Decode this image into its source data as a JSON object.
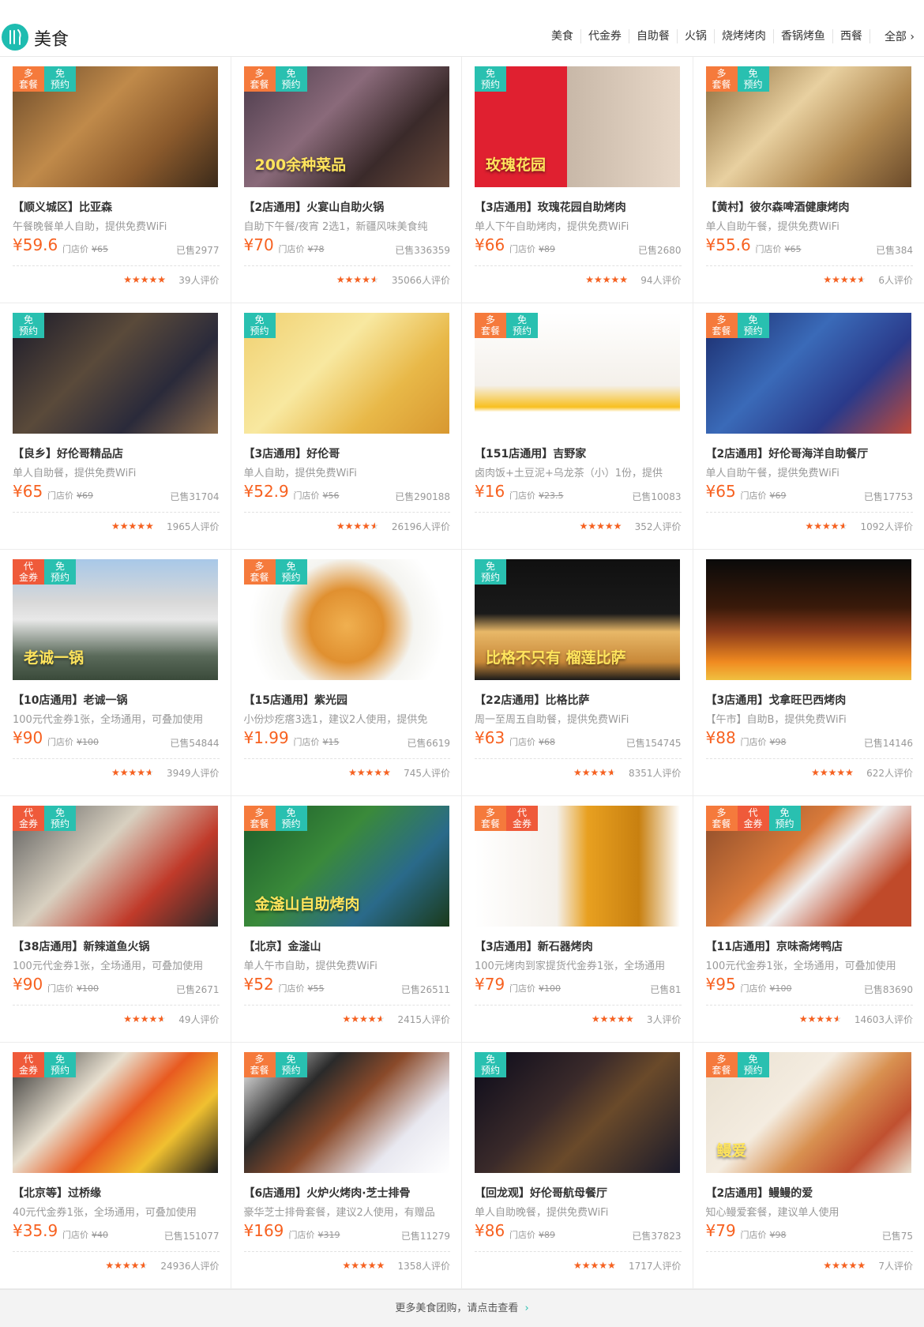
{
  "header": {
    "title": "美食",
    "icon": "fork-knife-icon",
    "nav": [
      "美食",
      "代金券",
      "自助餐",
      "火锅",
      "烧烤烤肉",
      "香锅烤鱼",
      "西餐"
    ],
    "all_label": "全部",
    "brand_color": "#1ebcb0"
  },
  "deals": [
    {
      "tags": [
        {
          "text": "多\n套餐",
          "type": "orange"
        },
        {
          "text": "免\n预约",
          "type": "teal"
        }
      ],
      "name": "【顺义城区】比亚森",
      "desc": "午餐晚餐单人自助，提供免费WiFi",
      "price": "¥59.6",
      "orig_label": "门店价",
      "orig": "¥65",
      "sold": "已售2977",
      "rating": 4.5,
      "reviews": "39人评价",
      "overlay": "",
      "grad": "linear-gradient(135deg,#6b4a2a,#c08a4a 40%,#8b5a2c 70%,#3b2a1a)"
    },
    {
      "tags": [
        {
          "text": "多\n套餐",
          "type": "orange"
        },
        {
          "text": "免\n预约",
          "type": "teal"
        }
      ],
      "name": "【2店通用】火宴山自助火锅",
      "desc": "自助下午餐/夜宵 2选1，新疆风味美食纯",
      "price": "¥70",
      "orig_label": "门店价",
      "orig": "¥78",
      "sold": "已售336359",
      "rating": 4.0,
      "reviews": "35066人评价",
      "overlay": "200余种菜品",
      "grad": "linear-gradient(135deg,#4a3a4a,#8a6a7a 40%,#3a2a2a 70%,#6a4a3a)"
    },
    {
      "tags": [
        {
          "text": "免\n预约",
          "type": "teal"
        }
      ],
      "name": "【3店通用】玫瑰花园自助烤肉",
      "desc": "单人下午自助烤肉，提供免费WiFi",
      "price": "¥66",
      "orig_label": "门店价",
      "orig": "¥89",
      "sold": "已售2680",
      "rating": 4.5,
      "reviews": "94人评价",
      "overlay": "玫瑰花园",
      "grad": "linear-gradient(90deg,#e02030 0,#e02030 45%,#c8b8a8 45%,#e8d8c8 100%)"
    },
    {
      "tags": [
        {
          "text": "多\n套餐",
          "type": "orange"
        },
        {
          "text": "免\n预约",
          "type": "teal"
        }
      ],
      "name": "【黄村】彼尔森啤酒健康烤肉",
      "desc": "单人自助午餐，提供免费WiFi",
      "price": "¥55.6",
      "orig_label": "门店价",
      "orig": "¥65",
      "sold": "已售384",
      "rating": 4.0,
      "reviews": "6人评价",
      "overlay": "",
      "grad": "linear-gradient(135deg,#8a6a3a,#e8d0a0 40%,#b08850 70%,#6a4a2a)"
    },
    {
      "tags": [
        {
          "text": "免\n预约",
          "type": "teal"
        }
      ],
      "name": "【良乡】好伦哥精品店",
      "desc": "单人自助餐，提供免费WiFi",
      "price": "¥65",
      "orig_label": "门店价",
      "orig": "¥69",
      "sold": "已售31704",
      "rating": 4.5,
      "reviews": "1965人评价",
      "overlay": "",
      "grad": "linear-gradient(135deg,#1a1a2a,#5a4a3a 40%,#2a2a3a 70%,#8a6a4a)"
    },
    {
      "tags": [
        {
          "text": "免\n预约",
          "type": "teal"
        }
      ],
      "name": "【3店通用】好伦哥",
      "desc": "单人自助，提供免费WiFi",
      "price": "¥52.9",
      "orig_label": "门店价",
      "orig": "¥56",
      "sold": "已售290188",
      "rating": 4.0,
      "reviews": "26196人评价",
      "overlay": "",
      "grad": "linear-gradient(135deg,#f0d070,#f8e8a0 40%,#e8b848 70%,#d89830)"
    },
    {
      "tags": [
        {
          "text": "多\n套餐",
          "type": "orange"
        },
        {
          "text": "免\n预约",
          "type": "teal"
        }
      ],
      "name": "【151店通用】吉野家",
      "desc": "卤肉饭+土豆泥+乌龙茶（小）1份，提供",
      "price": "¥16",
      "orig_label": "门店价",
      "orig": "¥23.5",
      "sold": "已售10083",
      "rating": 4.5,
      "reviews": "352人评价",
      "overlay": "",
      "grad": "linear-gradient(180deg,#ffffff 0,#f4f0ea 60%,#f8c020 78%,#ffffff 82%)"
    },
    {
      "tags": [
        {
          "text": "多\n套餐",
          "type": "orange"
        },
        {
          "text": "免\n预约",
          "type": "teal"
        }
      ],
      "name": "【2店通用】好伦哥海洋自助餐厅",
      "desc": "单人自助午餐，提供免费WiFi",
      "price": "¥65",
      "orig_label": "门店价",
      "orig": "¥69",
      "sold": "已售17753",
      "rating": 4.0,
      "reviews": "1092人评价",
      "overlay": "",
      "grad": "linear-gradient(135deg,#1a2a6a,#3a6ab8 40%,#2a3a8a 70%,#c04a3a)"
    },
    {
      "tags": [
        {
          "text": "代\n金券",
          "type": "red"
        },
        {
          "text": "免\n预约",
          "type": "teal"
        }
      ],
      "name": "【10店通用】老诚一锅",
      "desc": "100元代金券1张，全场通用，可叠加使用",
      "price": "¥90",
      "orig_label": "门店价",
      "orig": "¥100",
      "sold": "已售54844",
      "rating": 4.0,
      "reviews": "3949人评价",
      "overlay": "老诚一锅",
      "grad": "linear-gradient(180deg,#a8c8e8,#d8d8d8 35%,#e8e8e8 50%,#5a6a5a 80%,#3a4a3a)"
    },
    {
      "tags": [
        {
          "text": "多\n套餐",
          "type": "orange"
        },
        {
          "text": "免\n预约",
          "type": "teal"
        }
      ],
      "name": "【15店通用】紫光园",
      "desc": "小份炒疙瘩3选1，建议2人使用，提供免",
      "price": "¥1.99",
      "orig_label": "门店价",
      "orig": "¥15",
      "sold": "已售6619",
      "rating": 5.0,
      "reviews": "745人评价",
      "overlay": "",
      "grad": "radial-gradient(circle at 50% 55%,#f0b050 0,#e09030 30%,#f4f4f0 55%,#ffffff 80%)"
    },
    {
      "tags": [
        {
          "text": "免\n预约",
          "type": "teal"
        }
      ],
      "name": "【22店通用】比格比萨",
      "desc": "周一至周五自助餐，提供免费WiFi",
      "price": "¥63",
      "orig_label": "门店价",
      "orig": "¥68",
      "sold": "已售154745",
      "rating": 4.0,
      "reviews": "8351人评价",
      "overlay": "比格不只有 榴莲比萨",
      "grad": "linear-gradient(180deg,#101010 0,#1a1a1a 45%,#e8b868 60%,#c88838 85%,#1a1a1a)"
    },
    {
      "tags": [],
      "name": "【3店通用】戈拿旺巴西烤肉",
      "desc": "【午市】自助B，提供免费WiFi",
      "price": "¥88",
      "orig_label": "门店价",
      "orig": "¥98",
      "sold": "已售14146",
      "rating": 4.5,
      "reviews": "622人评价",
      "overlay": "",
      "grad": "linear-gradient(180deg,#0a0a0a 0,#3a1a0a 40%,#8a3a1a 60%,#f08a20 85%,#f0c040)"
    },
    {
      "tags": [
        {
          "text": "代\n金券",
          "type": "red"
        },
        {
          "text": "免\n预约",
          "type": "teal"
        }
      ],
      "name": "【38店通用】新辣道鱼火锅",
      "desc": "100元代金券1张，全场通用，可叠加使用",
      "price": "¥90",
      "orig_label": "门店价",
      "orig": "¥100",
      "sold": "已售2671",
      "rating": 4.0,
      "reviews": "49人评价",
      "overlay": "",
      "grad": "linear-gradient(135deg,#5a5a5a,#d8d0c0 40%,#c03a2a 70%,#2a2a2a)"
    },
    {
      "tags": [
        {
          "text": "多\n套餐",
          "type": "orange"
        },
        {
          "text": "免\n预约",
          "type": "teal"
        }
      ],
      "name": "【北京】金滏山",
      "desc": "单人午市自助，提供免费WiFi",
      "price": "¥52",
      "orig_label": "门店价",
      "orig": "¥55",
      "sold": "已售26511",
      "rating": 4.0,
      "reviews": "2415人评价",
      "overlay": "金滏山自助烤肉",
      "grad": "linear-gradient(135deg,#1a5a2a,#3a8a3a 40%,#2a6a8a 70%,#1a3a1a)"
    },
    {
      "tags": [
        {
          "text": "多\n套餐",
          "type": "orange"
        },
        {
          "text": "代\n金券",
          "type": "red"
        }
      ],
      "name": "【3店通用】新石器烤肉",
      "desc": "100元烤肉到家提货代金券1张，全场通用",
      "price": "¥79",
      "orig_label": "门店价",
      "orig": "¥100",
      "sold": "已售81",
      "rating": 5.0,
      "reviews": "3人评价",
      "overlay": "",
      "grad": "linear-gradient(90deg,#ffffff 0,#f4f0ea 40%,#e8a020 55%,#c88010 80%,#ffffff)"
    },
    {
      "tags": [
        {
          "text": "多\n套餐",
          "type": "orange"
        },
        {
          "text": "代\n金券",
          "type": "red"
        },
        {
          "text": "免\n预约",
          "type": "teal"
        }
      ],
      "name": "【11店通用】京味斋烤鸭店",
      "desc": "100元代金券1张，全场通用，可叠加使用",
      "price": "¥95",
      "orig_label": "门店价",
      "orig": "¥100",
      "sold": "已售83690",
      "rating": 4.0,
      "reviews": "14603人评价",
      "overlay": "",
      "grad": "linear-gradient(135deg,#8a4a2a,#d87a3a 40%,#f0f0f0 55%,#c04a2a 80%)"
    },
    {
      "tags": [
        {
          "text": "代\n金券",
          "type": "red"
        },
        {
          "text": "免\n预约",
          "type": "teal"
        }
      ],
      "name": "【北京等】过桥缘",
      "desc": "40元代金券1张，全场通用，可叠加使用",
      "price": "¥35.9",
      "orig_label": "门店价",
      "orig": "¥40",
      "sold": "已售151077",
      "rating": 4.0,
      "reviews": "24936人评价",
      "overlay": "",
      "grad": "linear-gradient(135deg,#2a2a2a,#e8e0d0 35%,#e85a20 55%,#f0c030 75%,#1a1a1a)"
    },
    {
      "tags": [
        {
          "text": "多\n套餐",
          "type": "orange"
        },
        {
          "text": "免\n预约",
          "type": "teal"
        }
      ],
      "name": "【6店通用】火炉火烤肉·芝士排骨",
      "desc": "豪华芝士排骨套餐，建议2人使用，有赠品",
      "price": "¥169",
      "orig_label": "门店价",
      "orig": "¥319",
      "sold": "已售11279",
      "rating": 4.5,
      "reviews": "1358人评价",
      "overlay": "",
      "grad": "linear-gradient(135deg,#ffffff,#2a2a2a 30%,#8a4a2a 50%,#e8e8f0 75%,#ffffff)"
    },
    {
      "tags": [
        {
          "text": "免\n预约",
          "type": "teal"
        }
      ],
      "name": "【回龙观】好伦哥航母餐厅",
      "desc": "单人自助晚餐，提供免费WiFi",
      "price": "¥86",
      "orig_label": "门店价",
      "orig": "¥89",
      "sold": "已售37823",
      "rating": 4.5,
      "reviews": "1717人评价",
      "overlay": "",
      "grad": "linear-gradient(135deg,#0a0a1a,#3a2a2a 40%,#6a4a2a 60%,#1a1a2a)"
    },
    {
      "tags": [
        {
          "text": "多\n套餐",
          "type": "orange"
        },
        {
          "text": "免\n预约",
          "type": "teal"
        }
      ],
      "name": "【2店通用】鳗鳗的爱",
      "desc": "知心鳗爱套餐，建议单人使用",
      "price": "¥79",
      "orig_label": "门店价",
      "orig": "¥98",
      "sold": "已售75",
      "rating": 5.0,
      "reviews": "7人评价",
      "overlay": "鳗爱",
      "grad": "linear-gradient(135deg,#e8e0d0,#f4ece0 40%,#d89050 60%,#c05030 80%,#e8e0d0)"
    }
  ],
  "footer": {
    "text": "更多美食团购，请点击查看",
    "arrow": "›"
  },
  "colors": {
    "price": "#f76120",
    "teal": "#29c0b0",
    "orange": "#f57a3c",
    "red": "#ef5a3a"
  }
}
